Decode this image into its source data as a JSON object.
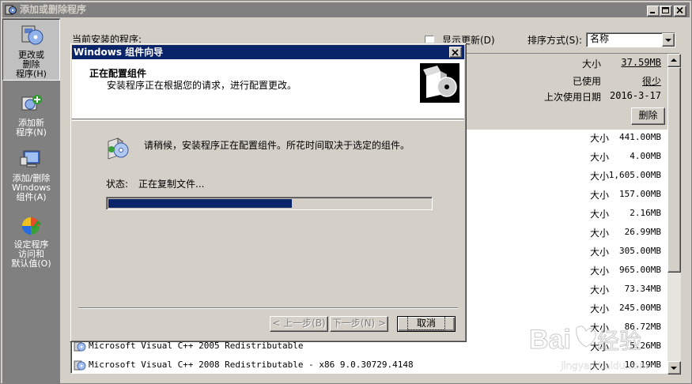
{
  "window": {
    "title": "添加或删除程序",
    "buttons": [
      "minimize",
      "maximize",
      "close"
    ]
  },
  "sidebar": {
    "items": [
      {
        "label_lines": [
          "更改或",
          "删除",
          "程序(H)"
        ],
        "icon": "change-remove-programs-icon",
        "active": true
      },
      {
        "label_lines": [
          "添加新",
          "程序(N)"
        ],
        "icon": "add-new-programs-icon",
        "active": false
      },
      {
        "label_lines": [
          "添加/删除",
          "Windows",
          "组件(A)"
        ],
        "icon": "windows-components-icon",
        "active": false
      },
      {
        "label_lines": [
          "设定程序",
          "访问和",
          "默认值(O)"
        ],
        "icon": "program-access-defaults-icon",
        "active": false
      }
    ]
  },
  "toolbar": {
    "current_programs_label": "当前安装的程序:",
    "show_updates_label": "显示更新(D)",
    "show_updates_checked": false,
    "sort_label": "排序方式(S):",
    "sort_value": "名称"
  },
  "selected_program": {
    "size_label": "大小",
    "size_value": "37.59MB",
    "used_label": "已使用",
    "used_value": "很少",
    "last_used_label": "上次使用日期",
    "last_used_value": "2016-3-17",
    "remove_label": "删除"
  },
  "program_rows": [
    {
      "name": "",
      "size_label": "大小",
      "size": "441.00MB"
    },
    {
      "name": "",
      "size_label": "大小",
      "size": "4.00MB"
    },
    {
      "name": "",
      "size_label": "大小",
      "size": "1,605.00MB"
    },
    {
      "name": "",
      "size_label": "大小",
      "size": "157.00MB"
    },
    {
      "name": "",
      "size_label": "大小",
      "size": "2.16MB"
    },
    {
      "name": "",
      "size_label": "大小",
      "size": "26.99MB"
    },
    {
      "name": "",
      "size_label": "大小",
      "size": "305.00MB"
    },
    {
      "name": "",
      "size_label": "大小",
      "size": "965.00MB"
    },
    {
      "name": "",
      "size_label": "大小",
      "size": "73.34MB"
    },
    {
      "name": "",
      "size_label": "大小",
      "size": "245.00MB"
    },
    {
      "name": "",
      "size_label": "大小",
      "size": "86.72MB"
    },
    {
      "name": "Microsoft Visual C++ 2005 Redistributable",
      "size_label": "大小",
      "size": "5.26MB"
    },
    {
      "name": "Microsoft Visual C++ 2008 Redistributable - x86 9.0.30729.4148",
      "size_label": "大小",
      "size": "10.19MB"
    }
  ],
  "wizard": {
    "title": "Windows 组件向导",
    "heading": "正在配置组件",
    "subheading": "安装程序正在根据您的请求，进行配置更改。",
    "message": "请稍候，安装程序正在配置组件。所花时间取决于选定的组件。",
    "status_label": "状态:",
    "status_value": "正在复制文件...",
    "progress_fraction": 0.57,
    "back_label": "< 上一步(B)",
    "next_label": "下一步(N) >",
    "cancel_label": "取消"
  },
  "watermark": {
    "text": "Bai度经验",
    "sub": "jingyan.baidu.com"
  },
  "colors": {
    "accent": "#0a246a",
    "face": "#d4d0c8",
    "sidebar": "#808080"
  }
}
